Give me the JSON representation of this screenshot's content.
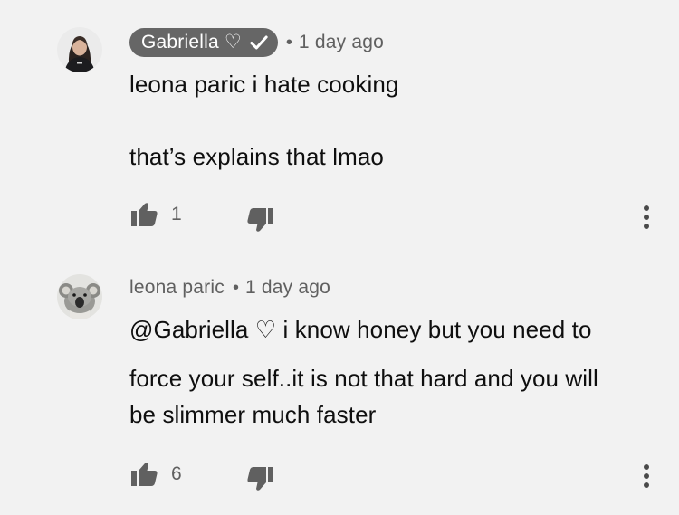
{
  "comments": [
    {
      "author": "Gabriella ♡",
      "is_channel_owner": true,
      "time": "1 day ago",
      "body": [
        "leona paric i hate cooking",
        "",
        "that’s explains that lmao"
      ],
      "likes": "1",
      "icons": {
        "avatar": "profile-photo",
        "verified": "check-icon",
        "like": "thumbs-up-icon",
        "dislike": "thumbs-down-icon",
        "more": "more-vert-icon"
      }
    },
    {
      "author": "leona paric",
      "is_channel_owner": false,
      "time": "1 day ago",
      "body": [
        "@Gabriella ♡ i know honey but you need to",
        "force your self..it is not that hard  and you will",
        "be slimmer  much faster"
      ],
      "likes": "6",
      "icons": {
        "avatar": "koala-photo",
        "like": "thumbs-up-icon",
        "dislike": "thumbs-down-icon",
        "more": "more-vert-icon"
      }
    }
  ],
  "colors": {
    "background": "#f2f2f2",
    "owner_badge": "#666666",
    "secondary_text": "#606060",
    "primary_text": "#0f0f0f",
    "icon": "#606060"
  }
}
